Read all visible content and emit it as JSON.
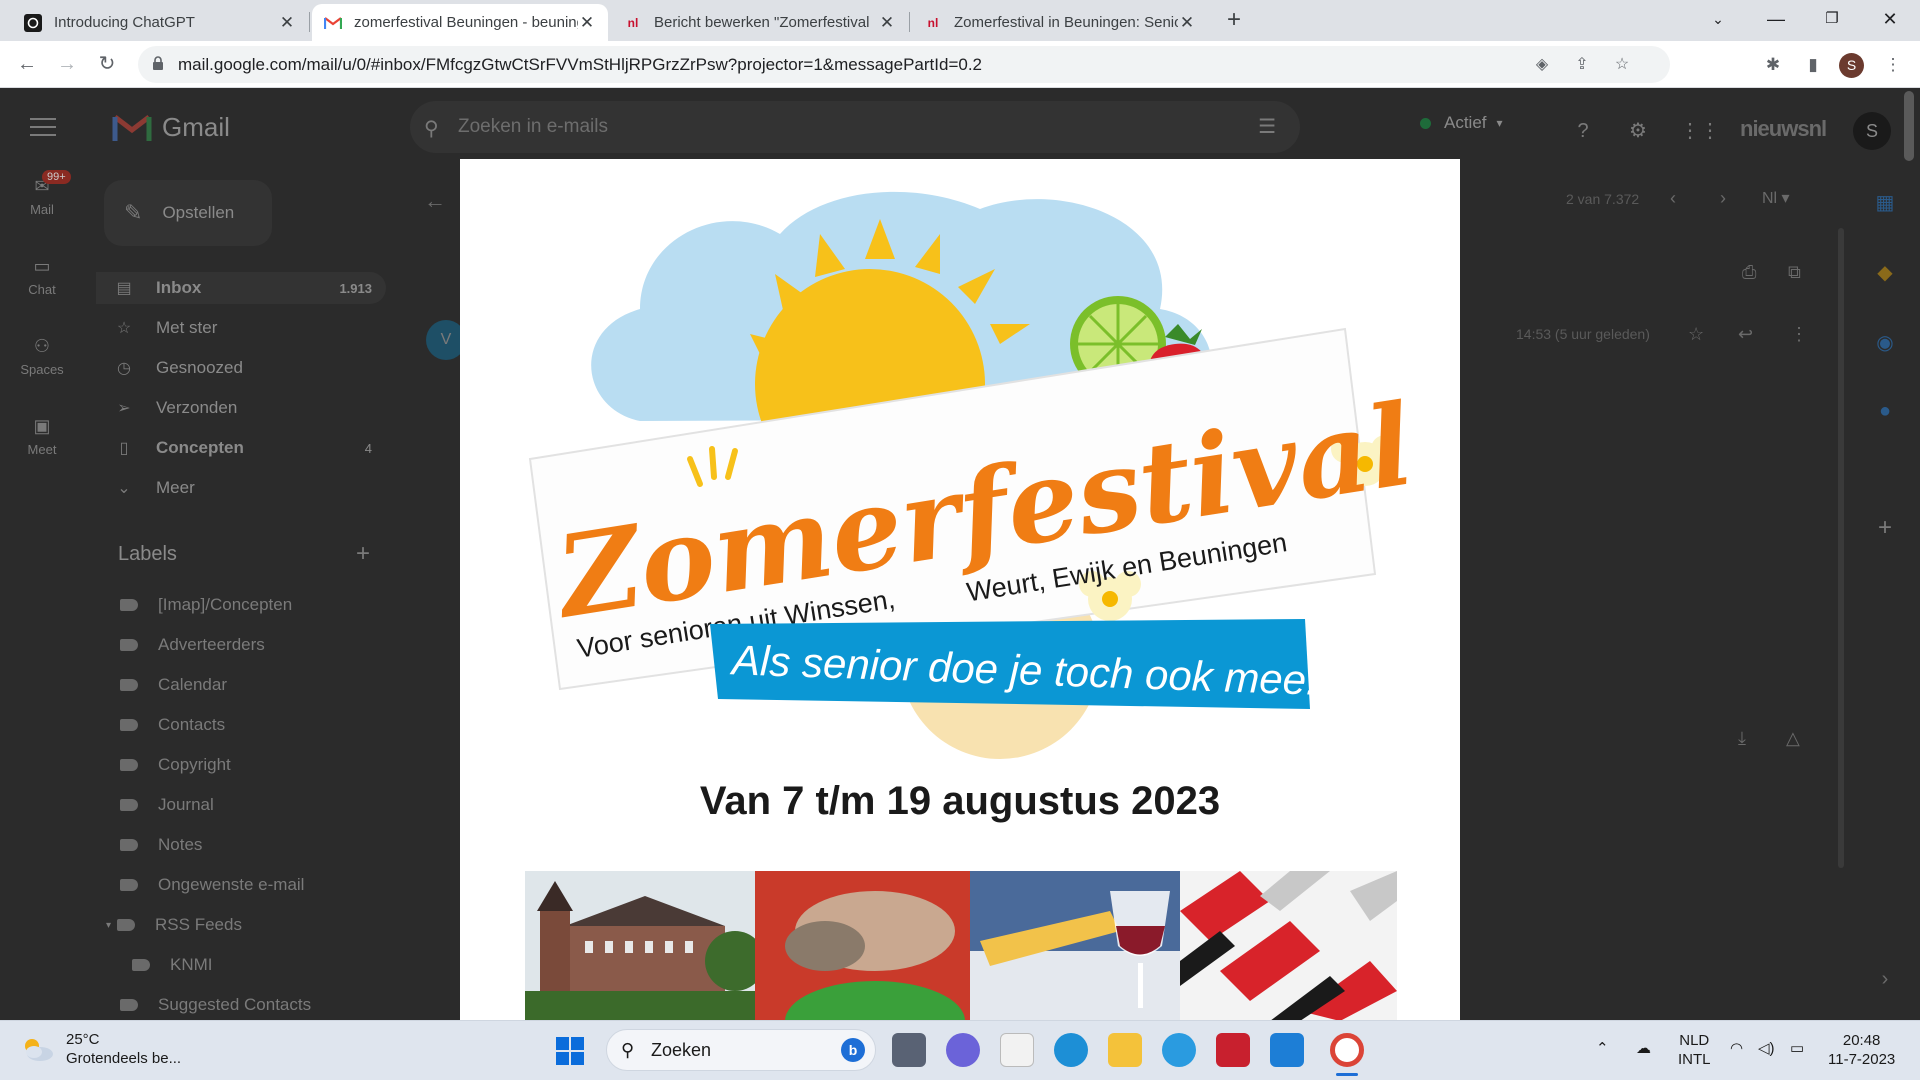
{
  "browser": {
    "tabs": [
      {
        "title": "Introducing ChatGPT",
        "icon": "chatgpt-icon"
      },
      {
        "title": "zomerfestival Beuningen - beuningen",
        "icon": "gmail-icon",
        "active": true
      },
      {
        "title": "Bericht bewerken \"Zomerfestival",
        "icon": "nieuwsnl-icon"
      },
      {
        "title": "Zomerfestival in Beuningen: Senioren",
        "icon": "nieuwsnl-icon"
      }
    ],
    "url": "mail.google.com/mail/u/0/#inbox/FMfcgzGtwCtSrFVVmStHljRPGrzZrPsw?projector=1&messagePartId=0.2",
    "profile_initial": "S"
  },
  "gmail": {
    "app_name": "Gmail",
    "search_placeholder": "Zoeken in e-mails",
    "status": "Actief",
    "brand": "nieuwsnl",
    "avatar_initial": "S",
    "rail": [
      {
        "label": "Mail",
        "badge": "99+"
      },
      {
        "label": "Chat"
      },
      {
        "label": "Spaces"
      },
      {
        "label": "Meet"
      }
    ],
    "compose_label": "Opstellen",
    "nav": [
      {
        "label": "Inbox",
        "count": "1.913",
        "icon": "inbox-icon",
        "bold": true,
        "selected": true
      },
      {
        "label": "Met ster",
        "count": "",
        "icon": "star-icon"
      },
      {
        "label": "Gesnoozed",
        "count": "",
        "icon": "clock-icon"
      },
      {
        "label": "Verzonden",
        "count": "",
        "icon": "send-icon"
      },
      {
        "label": "Concepten",
        "count": "4",
        "icon": "draft-icon",
        "bold": true
      },
      {
        "label": "Meer",
        "count": "",
        "icon": "chevron-down-icon"
      }
    ],
    "labels_title": "Labels",
    "labels": [
      "[Imap]/Concepten",
      "Adverteerders",
      "Calendar",
      "Contacts",
      "Copyright",
      "Journal",
      "Notes",
      "Ongewenste e-mail",
      "RSS Feeds",
      "KNMI",
      "Suggested Contacts"
    ],
    "pager": "2 van 7.372",
    "timestamp": "14:53 (5 uur geleden)",
    "sender_initial": "V"
  },
  "projector": {
    "logo_word": "Zomerfestival",
    "tagline": "Voor senioren uit Winssen, Weurt, Ewijk en Beuningen",
    "tagline_left": "Voor senioren uit Winssen,",
    "tagline_right": "Weurt, Ewijk en Beuningen",
    "banner": "Als senior doe je toch ook mee!",
    "dates": "Van 7 t/m 19 augustus 2023"
  },
  "taskbar": {
    "temperature": "25°C",
    "weather_desc": "Grotendeels be...",
    "search_label": "Zoeken",
    "lang_top": "NLD",
    "lang_bottom": "INTL",
    "time": "20:48",
    "date": "11-7-2023"
  }
}
